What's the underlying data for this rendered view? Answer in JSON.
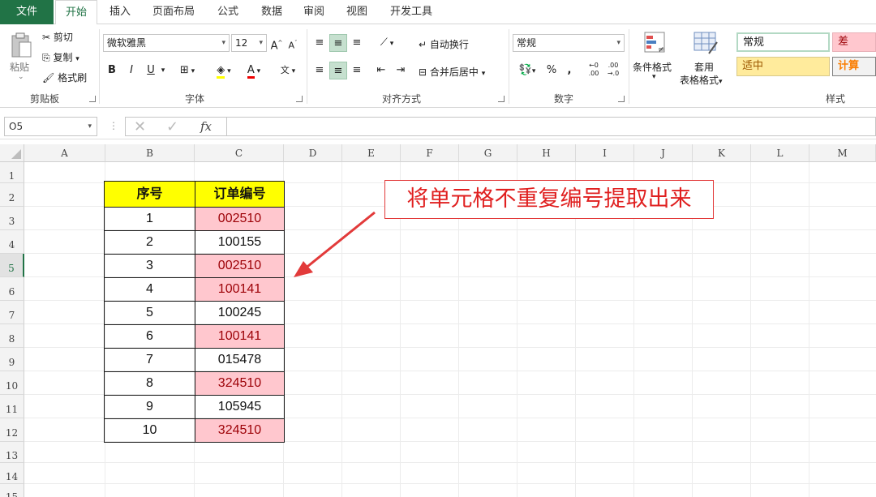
{
  "tabs": [
    "文件",
    "开始",
    "插入",
    "页面布局",
    "公式",
    "数据",
    "审阅",
    "视图",
    "开发工具"
  ],
  "ribbon": {
    "clipboard": {
      "paste": "粘贴",
      "cut": "剪切",
      "copy": "复制",
      "format_painter": "格式刷",
      "label": "剪贴板"
    },
    "font": {
      "name": "微软雅黑",
      "size": "12",
      "bold": "B",
      "italic": "I",
      "underline": "U",
      "label": "字体"
    },
    "alignment": {
      "wrap": "自动换行",
      "merge": "合并后居中",
      "label": "对齐方式"
    },
    "number": {
      "format": "常规",
      "label": "数字"
    },
    "styles": {
      "conditional": "条件格式",
      "table_style_1": "套用",
      "table_style_2": "表格格式",
      "normal": "常规",
      "bad": "差",
      "neutral": "适中",
      "calc": "计算",
      "label": "样式"
    }
  },
  "formula_bar": {
    "name_box": "O5",
    "fx": "fx",
    "value": ""
  },
  "columns": [
    "A",
    "B",
    "C",
    "D",
    "E",
    "F",
    "G",
    "H",
    "I",
    "J",
    "K",
    "L",
    "M"
  ],
  "rows": [
    "1",
    "2",
    "3",
    "4",
    "5",
    "6",
    "7",
    "8",
    "9",
    "10",
    "11",
    "12",
    "13",
    "14",
    "15"
  ],
  "table": {
    "headers": [
      "序号",
      "订单编号"
    ],
    "rows": [
      {
        "no": "1",
        "id": "002510",
        "dup": true
      },
      {
        "no": "2",
        "id": "100155",
        "dup": false
      },
      {
        "no": "3",
        "id": "002510",
        "dup": true
      },
      {
        "no": "4",
        "id": "100141",
        "dup": true
      },
      {
        "no": "5",
        "id": "100245",
        "dup": false
      },
      {
        "no": "6",
        "id": "100141",
        "dup": true
      },
      {
        "no": "7",
        "id": "015478",
        "dup": false
      },
      {
        "no": "8",
        "id": "324510",
        "dup": true
      },
      {
        "no": "9",
        "id": "105945",
        "dup": false
      },
      {
        "no": "10",
        "id": "324510",
        "dup": true
      }
    ]
  },
  "callout": "将单元格不重复编号提取出来",
  "colors": {
    "accent": "#217346",
    "dup_fill": "#ffc7ce",
    "dup_text": "#9c0006",
    "header_fill": "#ffff00",
    "callout": "#e02020"
  }
}
